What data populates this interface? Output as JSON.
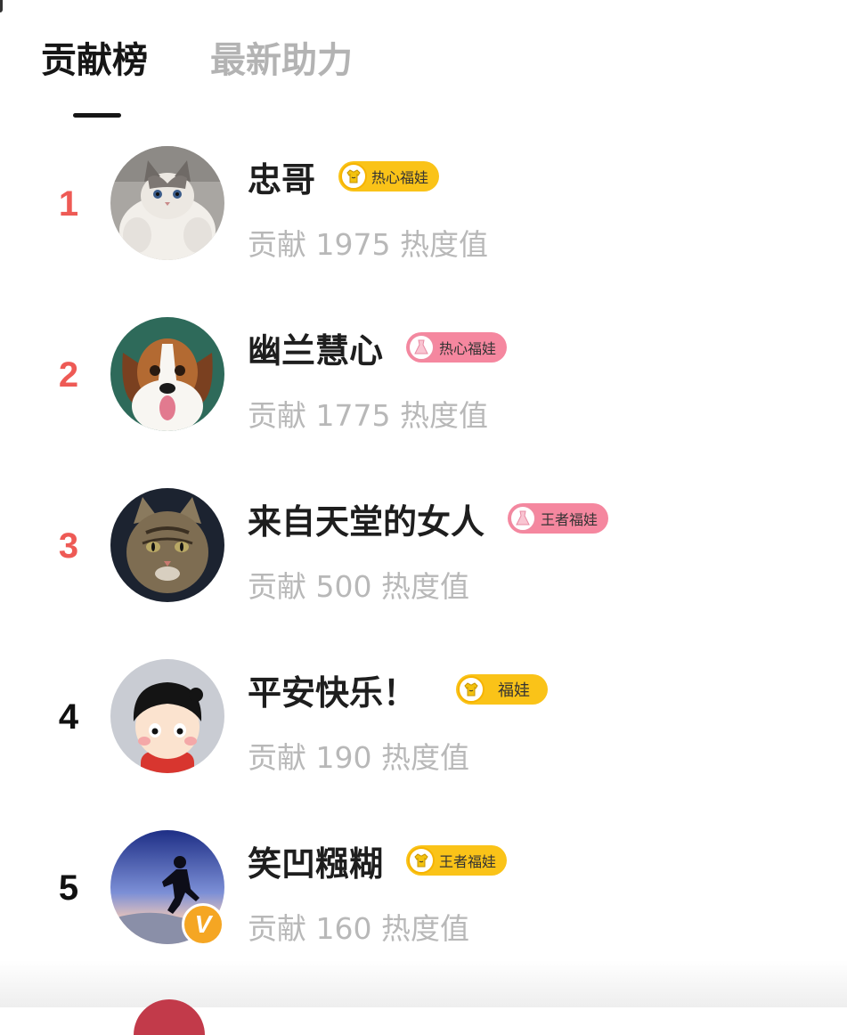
{
  "tabs": [
    {
      "label": "贡献榜",
      "active": true
    },
    {
      "label": "最新助力",
      "active": false
    }
  ],
  "list": [
    {
      "rank": "1",
      "name": "忠哥",
      "badge": "热心福娃",
      "badge_style": "yellow",
      "badge_icon": "shirt-icon",
      "contribution": "贡献 1975 热度值",
      "avatar": "ragdoll-cat-avatar"
    },
    {
      "rank": "2",
      "name": "幽兰慧心",
      "badge": "热心福娃",
      "badge_style": "pink",
      "badge_icon": "dress-icon",
      "contribution": "贡献 1775 热度值",
      "avatar": "beagle-dog-avatar"
    },
    {
      "rank": "3",
      "name": "来自天堂的女人",
      "badge": "王者福娃",
      "badge_style": "pink",
      "badge_icon": "dress-icon",
      "contribution": "贡献 500 热度值",
      "avatar": "tabby-cat-avatar"
    },
    {
      "rank": "4",
      "name": "平安快乐！",
      "badge": "福娃",
      "badge_style": "yellow",
      "badge_icon": "shirt-icon",
      "contribution": "贡献 190 热度值",
      "avatar": "cartoon-boy-avatar"
    },
    {
      "rank": "5",
      "name": "笑凹糨糊",
      "badge": "王者福娃",
      "badge_style": "yellow",
      "badge_icon": "shirt-icon",
      "contribution": "贡献 160 热度值",
      "avatar": "jumping-person-avatar",
      "verified_badge": "V"
    }
  ],
  "colors": {
    "rank_top": "#ee5a55",
    "badge_yellow": "#fac318",
    "badge_pink": "#f5879f",
    "verified": "#f5a623"
  }
}
